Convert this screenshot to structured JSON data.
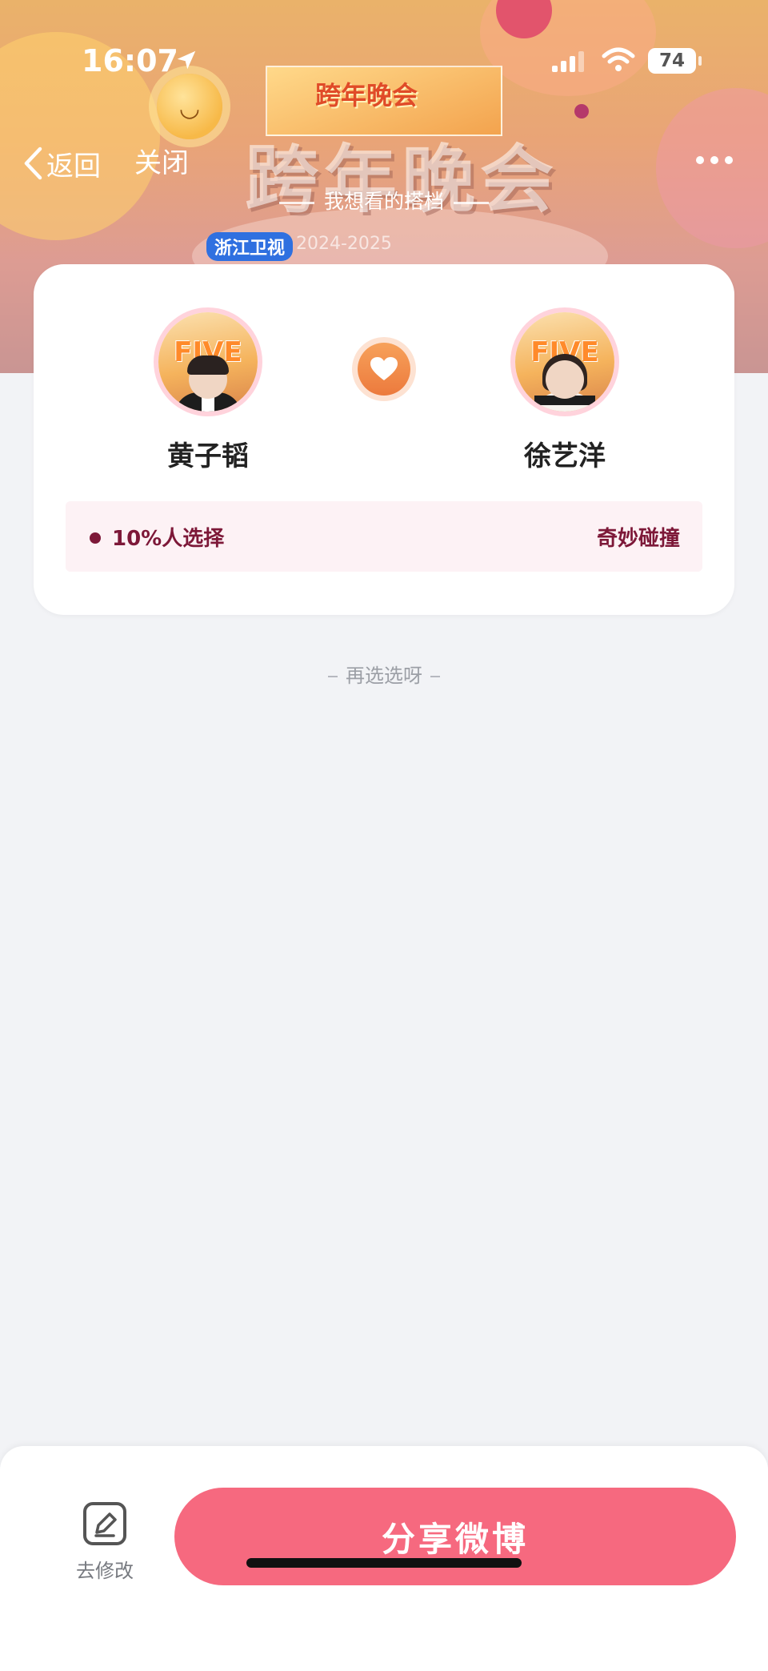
{
  "status_bar": {
    "time": "16:07",
    "battery": "74"
  },
  "nav": {
    "back_label": "返回",
    "close_label": "关闭"
  },
  "banner": {
    "title": "跨年晚会",
    "program_thumb_title": "跨年晚会",
    "subtitle": "我想看的搭档",
    "channel": "浙江卫视",
    "date_text": "2024-2025"
  },
  "pairing": {
    "left": {
      "name": "黄子韬",
      "avatar_text": "FIVE"
    },
    "right": {
      "name": "徐艺洋",
      "avatar_text": "FIVE"
    },
    "percent_text": "10%人选择",
    "tag": "奇妙碰撞"
  },
  "reselect_label": "再选选呀",
  "bottom": {
    "edit_label": "去修改",
    "share_label": "分享微博"
  },
  "colors": {
    "accent_pink": "#f6697f",
    "stat_text": "#7d1838",
    "heart_orange": "#ec7a3d"
  },
  "icons": {
    "back": "chevron-left-icon",
    "more": "ellipsis-icon",
    "heart": "heart-icon",
    "edit": "pencil-square-icon",
    "location": "location-arrow-icon",
    "wifi": "wifi-icon",
    "signal": "cellular-signal-icon"
  }
}
